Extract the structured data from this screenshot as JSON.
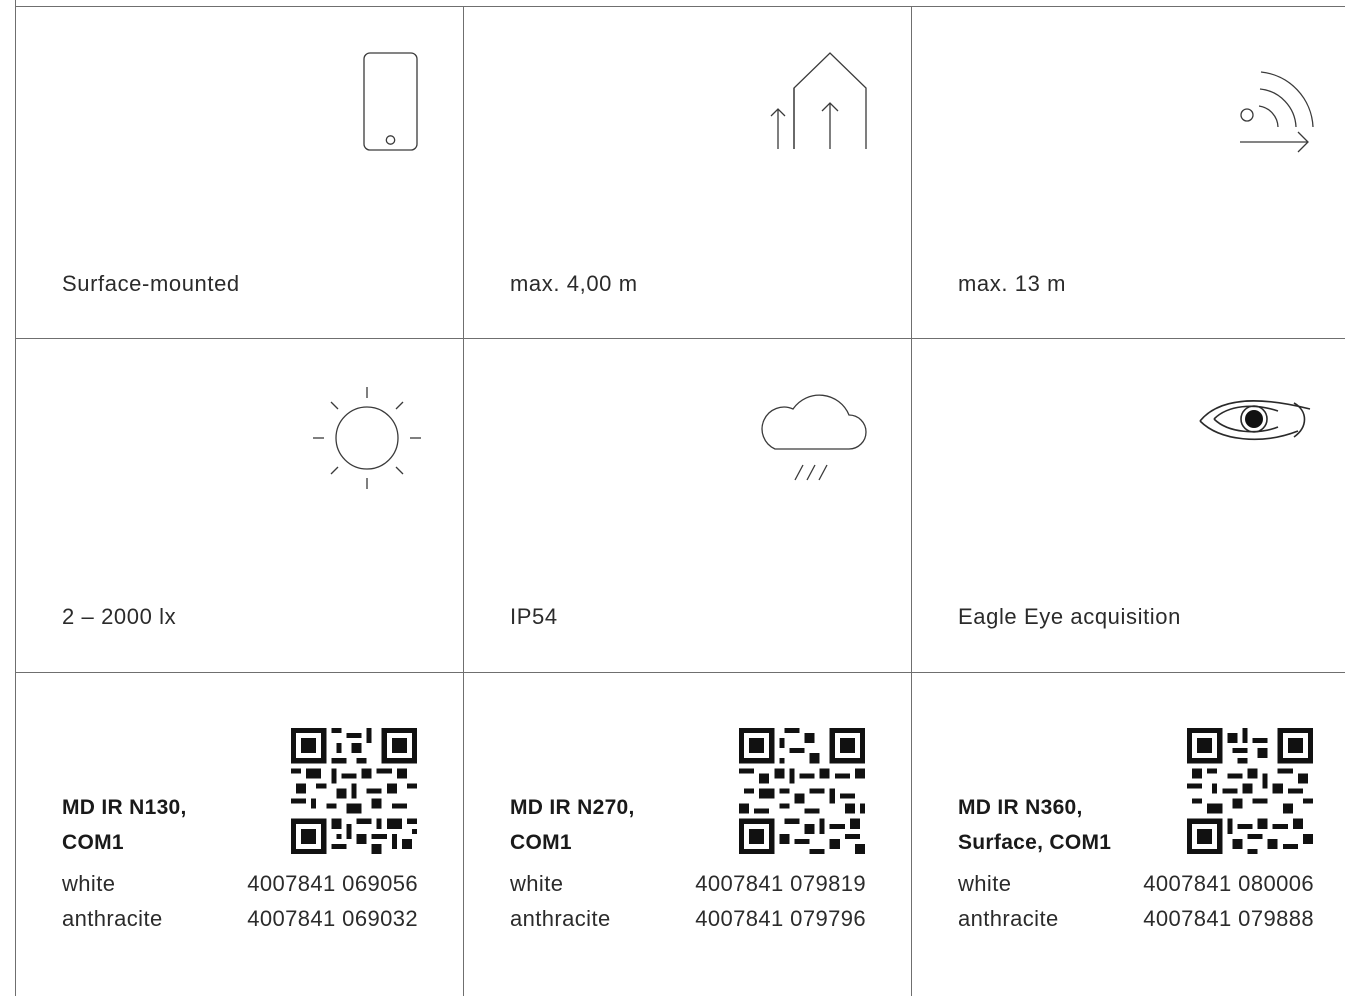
{
  "features": [
    {
      "icon": "smartphone-icon",
      "label": "Surface-mounted"
    },
    {
      "icon": "mounting-height-icon",
      "label": "max. 4,00 m"
    },
    {
      "icon": "detection-range-icon",
      "label": "max. 13 m"
    },
    {
      "icon": "sun-icon",
      "label": "2 – 2000 lx"
    },
    {
      "icon": "rain-cloud-icon",
      "label": "IP54"
    },
    {
      "icon": "eye-icon",
      "label": "Eagle Eye acquisition"
    }
  ],
  "products": [
    {
      "title_line1": "MD IR N130,",
      "title_line2": "COM1",
      "variants": [
        {
          "color": "white",
          "ean": "4007841 069056"
        },
        {
          "color": "anthracite",
          "ean": "4007841 069032"
        }
      ],
      "qr_icon": "qr-code-icon"
    },
    {
      "title_line1": "MD IR N270,",
      "title_line2": "COM1",
      "variants": [
        {
          "color": "white",
          "ean": "4007841 079819"
        },
        {
          "color": "anthracite",
          "ean": "4007841 079796"
        }
      ],
      "qr_icon": "qr-code-icon"
    },
    {
      "title_line1": "MD IR N360,",
      "title_line2": "Surface, COM1",
      "variants": [
        {
          "color": "white",
          "ean": "4007841 080006"
        },
        {
          "color": "anthracite",
          "ean": "4007841 079888"
        }
      ],
      "qr_icon": "qr-code-icon"
    }
  ]
}
